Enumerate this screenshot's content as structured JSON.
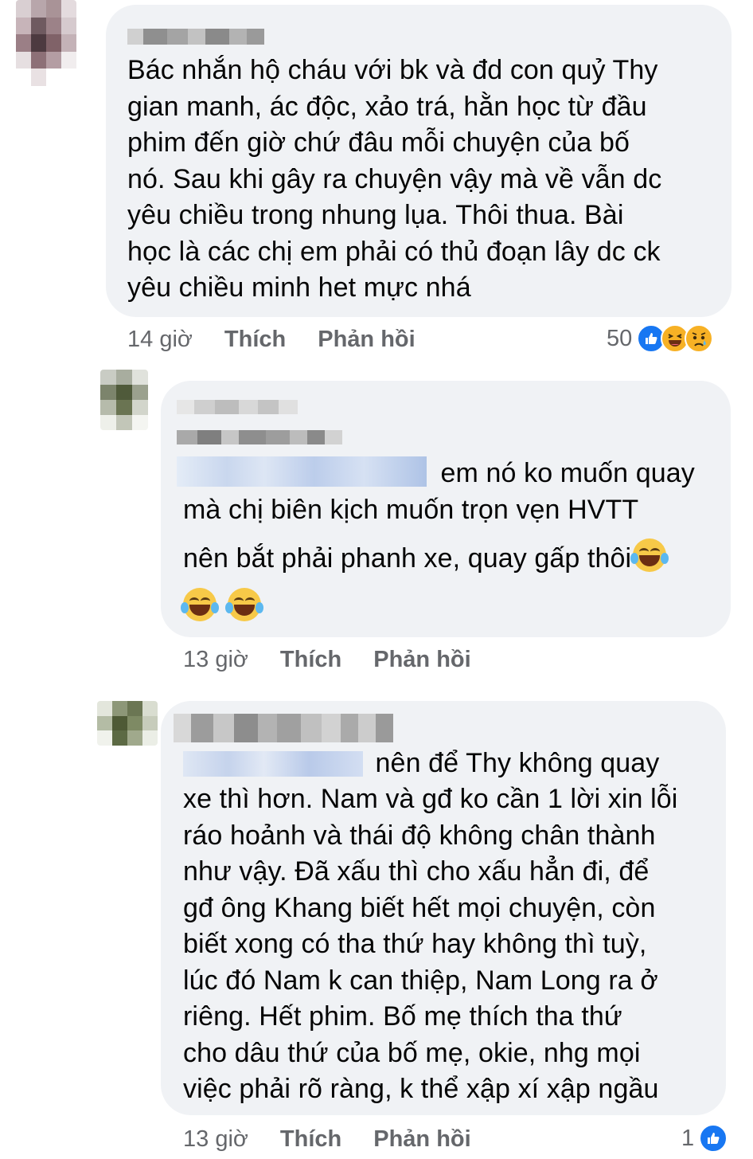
{
  "comments": [
    {
      "time": "14 giờ",
      "like_label": "Thích",
      "reply_label": "Phản hồi",
      "reaction_count": "50",
      "reactions": [
        "like-icon",
        "haha-icon",
        "sad-icon"
      ],
      "lines": [
        "Bác nhắn hộ cháu với bk và đd con quỷ Thy",
        "gian manh, ác độc, xảo trá, hằn học từ đầu",
        "phim đến giờ chứ đâu mỗi chuyện của bố",
        "nó. Sau khi gây ra chuyện vậy mà về vẫn dc",
        "yêu chiều trong nhung lụa. Thôi thua. Bài",
        "học là các chị em phải có thủ đoạn lây dc ck",
        "yêu chiều minh het  mực nhá"
      ]
    },
    {
      "time": "13 giờ",
      "like_label": "Thích",
      "reply_label": "Phản hồi",
      "lines": [
        "em nó ko muốn quay",
        "mà chị biên kịch muốn trọn vẹn HVTT",
        "nên bắt phải phanh xe, quay gấp thôi"
      ]
    },
    {
      "time": "13 giờ",
      "like_label": "Thích",
      "reply_label": "Phản hồi",
      "reaction_count": "1",
      "reactions": [
        "like-icon"
      ],
      "lines": [
        "nên để Thy không quay",
        "xe thì hơn. Nam và gđ ko cần 1 lời xin lỗi",
        "ráo hoảnh và thái độ không chân thành",
        "như vậy. Đã xấu thì cho xấu hẳn đi, để",
        "gđ ông Khang biết hết mọi chuyện, còn",
        "biết xong có tha thứ hay không thì tuỳ,",
        "lúc đó Nam k can thiệp, Nam Long ra ở",
        "riêng. Hết phim. Bố mẹ thích tha thứ",
        "cho dâu thứ của bố mẹ, okie, nhg mọi",
        "việc phải rõ ràng, k thể xập xí xập ngầu"
      ]
    }
  ],
  "colors": {
    "bubble": "#f0f2f5",
    "meta_text": "#65676b",
    "like_blue": "#1877f2",
    "emoji_yellow": "#f7b125"
  }
}
